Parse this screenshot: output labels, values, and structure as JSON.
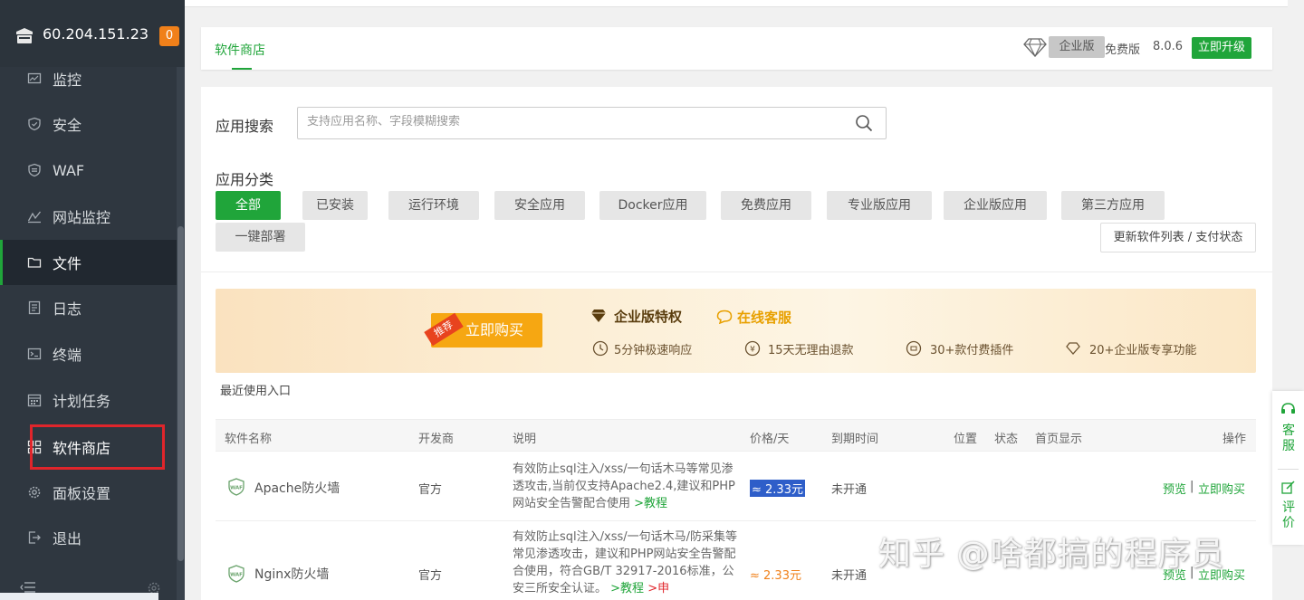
{
  "sidebar": {
    "server_ip": "60.204.151.23",
    "badge_count": "0",
    "items": [
      {
        "label": "监控",
        "icon": "monitor-icon"
      },
      {
        "label": "安全",
        "icon": "shield-icon"
      },
      {
        "label": "WAF",
        "icon": "waf-shield-icon"
      },
      {
        "label": "网站监控",
        "icon": "site-monitor-icon"
      },
      {
        "label": "文件",
        "icon": "folder-icon"
      },
      {
        "label": "日志",
        "icon": "log-icon"
      },
      {
        "label": "终端",
        "icon": "terminal-icon"
      },
      {
        "label": "计划任务",
        "icon": "calendar-icon"
      },
      {
        "label": "软件商店",
        "icon": "grid-icon"
      },
      {
        "label": "面板设置",
        "icon": "gear-icon"
      },
      {
        "label": "退出",
        "icon": "logout-icon"
      }
    ]
  },
  "topbar": {
    "tab_label": "软件商店",
    "edition_label": "企业版",
    "free_label": "免费版",
    "version": "8.0.6",
    "upgrade_label": "立即升级"
  },
  "search": {
    "label": "应用搜索",
    "placeholder": "支持应用名称、字段模糊搜索",
    "value": ""
  },
  "categories": {
    "label": "应用分类",
    "items": [
      "全部",
      "已安装",
      "运行环境",
      "安全应用",
      "Docker应用",
      "免费应用",
      "专业版应用",
      "企业版应用",
      "第三方应用",
      "一键部署"
    ],
    "selected": "全部",
    "refresh_label": "更新软件列表 / 支付状态"
  },
  "banner": {
    "tag": "推荐",
    "buy_label": "立即购买",
    "title": "企业版特权",
    "service": "在线客服",
    "features": [
      "5分钟极速响应",
      "15天无理由退款",
      "30+款付费插件",
      "20+企业版专享功能"
    ]
  },
  "recent_label": "最近使用入口",
  "table": {
    "headers": [
      "软件名称",
      "开发商",
      "说明",
      "价格/天",
      "到期时间",
      "位置",
      "状态",
      "首页显示",
      "操作"
    ],
    "rows": [
      {
        "name": "Apache防火墙",
        "vendor": "官方",
        "desc": "有效防止sql注入/xss/一句话木马等常见渗透攻击,当前仅支持Apache2.4,建议和PHP网站安全告警配合使用",
        "desc_link": ">教程",
        "desc_extra": "",
        "price": "≈ 2.33元",
        "expire": "未开通",
        "preview": "预览",
        "sep": "|",
        "buy": "立即购买"
      },
      {
        "name": "Nginx防火墙",
        "vendor": "官方",
        "desc": "有效防止sql注入/xss/一句话木马/防采集等常见渗透攻击，建议和PHP网站安全告警配合使用，符合GB/T 32917-2016标准，公安三所安全认证。",
        "desc_link": ">教程",
        "desc_extra": ">申",
        "price": "≈ 2.33元",
        "expire": "未开通",
        "preview": "预览",
        "sep": "|",
        "buy": "立即购买"
      }
    ]
  },
  "float": {
    "service": "客服",
    "review": "评价"
  },
  "watermark": "知乎 @啥都搞的程序员",
  "colors": {
    "accent": "#20a53a",
    "sidebar_bg": "#2f3740",
    "badge": "#f0801a",
    "highlight": "#e0252b"
  }
}
